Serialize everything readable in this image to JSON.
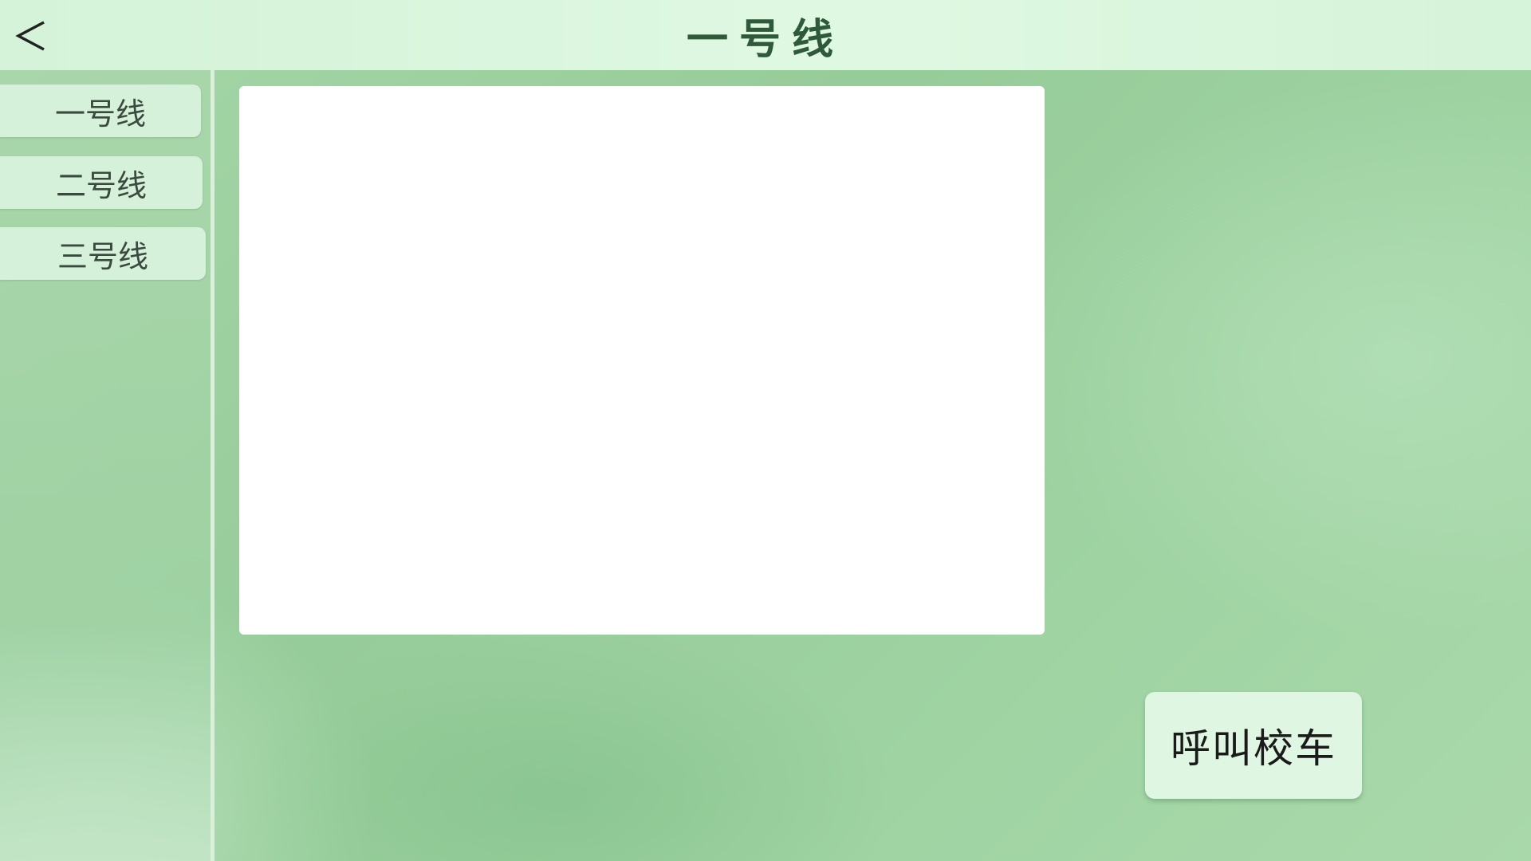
{
  "header": {
    "title": "一号线",
    "back_icon": "chevron-left-icon"
  },
  "sidebar": {
    "items": [
      {
        "label": "一号线"
      },
      {
        "label": "二号线"
      },
      {
        "label": "三号线"
      }
    ]
  },
  "actions": {
    "call_bus_label": "呼叫校车"
  },
  "colors": {
    "header_bg": "#dff8e2",
    "title_text": "#2e5a3a",
    "nav_item_bg": "#d6f1d9",
    "background": "#9fd3a2",
    "panel_bg": "#ffffff"
  }
}
